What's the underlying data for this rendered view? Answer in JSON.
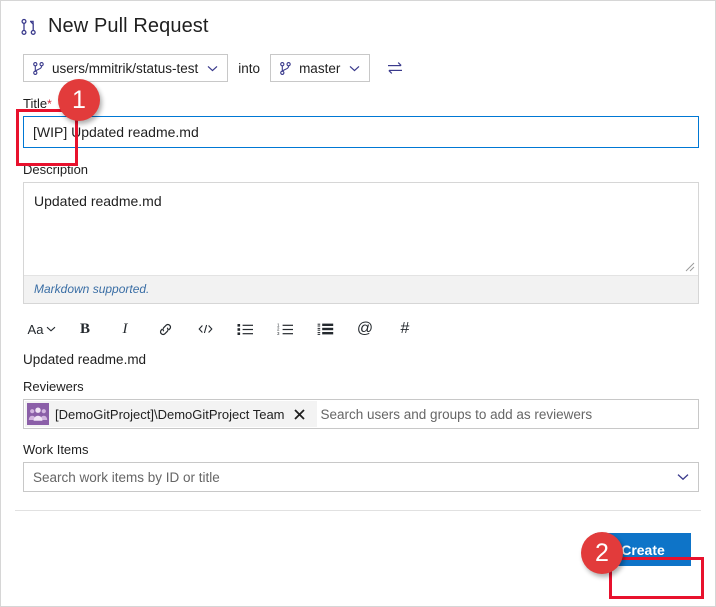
{
  "header": {
    "title": "New Pull Request",
    "icon": "pull-request-icon"
  },
  "branches": {
    "source": "users/mmitrik/status-test",
    "into_label": "into",
    "target": "master",
    "swap_icon": "swap-arrows-icon",
    "branch_icon": "git-branch-icon",
    "chevron_icon": "chevron-down-icon"
  },
  "title_field": {
    "label": "Title",
    "required_marker": "*",
    "value": "[WIP] Updated readme.md",
    "highlight_token": "[WIP]"
  },
  "description_field": {
    "label": "Description",
    "value": "Updated readme.md",
    "markdown_note": "Markdown supported.",
    "resize_grip": "resize-grip-icon"
  },
  "markdown_toolbar": {
    "items": [
      {
        "name": "font-size-dropdown",
        "label": "Aa",
        "icon": "chevron-down-icon"
      },
      {
        "name": "bold-button",
        "label": "B",
        "icon": "bold-icon"
      },
      {
        "name": "italic-button",
        "label": "I",
        "icon": "italic-icon"
      },
      {
        "name": "link-button",
        "label": "",
        "icon": "link-icon"
      },
      {
        "name": "code-button",
        "label": "",
        "icon": "code-icon"
      },
      {
        "name": "bulleted-list-button",
        "label": "",
        "icon": "bulleted-list-icon"
      },
      {
        "name": "numbered-list-button",
        "label": "",
        "icon": "numbered-list-icon"
      },
      {
        "name": "task-list-button",
        "label": "",
        "icon": "task-list-icon"
      },
      {
        "name": "mention-button",
        "label": "@",
        "icon": "at-mention-icon"
      },
      {
        "name": "work-item-link-button",
        "label": "#",
        "icon": "hash-icon"
      }
    ]
  },
  "preview_text": "Updated readme.md",
  "reviewers_field": {
    "label": "Reviewers",
    "chips": [
      {
        "text": "[DemoGitProject]\\DemoGitProject Team",
        "avatar_icon": "group-avatar-icon",
        "remove_icon": "close-icon",
        "avatar_color": "#8b5fa8"
      }
    ],
    "placeholder": "Search users and groups to add as reviewers"
  },
  "work_items_field": {
    "label": "Work Items",
    "placeholder": "Search work items by ID or title",
    "chevron_icon": "chevron-down-icon"
  },
  "footer": {
    "create_label": "Create"
  },
  "annotations": {
    "badge_1": "1",
    "badge_2": "2",
    "badge_color": "#e23b3b",
    "rect_color": "#e8112d"
  }
}
